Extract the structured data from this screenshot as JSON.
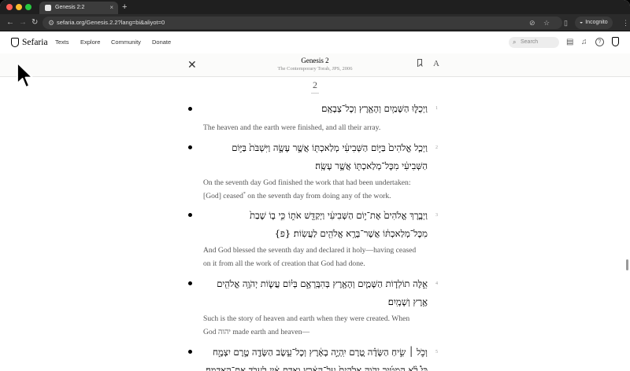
{
  "browser": {
    "tab_title": "Genesis 2:2",
    "tab_close": "×",
    "new_tab": "+",
    "url": "sefaria.org/Genesis.2.2?lang=bi&aliyot=0",
    "incognito_label": "Incognito",
    "icons": [
      "back-icon",
      "forward-icon",
      "reload-icon",
      "site-info-icon",
      "eye-slash-icon",
      "star-icon",
      "sidebar-icon",
      "incognito-icon",
      "menu-icon"
    ]
  },
  "site": {
    "logo_text": "Sefaria",
    "nav": [
      "Texts",
      "Explore",
      "Community",
      "Donate"
    ],
    "search_placeholder": "Search",
    "icons": [
      "search-icon",
      "saved-icon",
      "bell-icon",
      "help-icon",
      "sefaria-mini-logo"
    ]
  },
  "reader": {
    "close": "✕",
    "title": "Genesis 2",
    "subtitle": "The Contemporary Torah, JPS, 2006",
    "font_button": "A"
  },
  "chapter": "2",
  "verses": [
    {
      "num": "1",
      "hebrew": "וַיְכֻלּ֛וּ הַשָּׁמַ֥יִם וְהָאָ֖רֶץ וְכׇל־צְבָאָֽם׃",
      "english": "The heaven and the earth were finished, and all their array."
    },
    {
      "num": "2",
      "hebrew": "וַיְכַ֤ל אֱלֹהִים֙ בַּיּ֣וֹם הַשְּׁבִיעִ֔י מְלַאכְתּ֖וֹ אֲשֶׁ֣ר עָשָׂ֑ה וַיִּשְׁבֹּת֙ בַּיּ֣וֹם הַשְּׁבִיעִ֔י מִכׇּל־מְלַאכְתּ֖וֹ אֲשֶׁ֥ר עָשָֽׂה׃",
      "english_a": "On the seventh day God finished the work that had been undertaken:",
      "english_b1": "[God] ceased",
      "english_sup": "*",
      "english_b2": " on the seventh day from doing any of the work."
    },
    {
      "num": "3",
      "hebrew": "וַיְבָ֤רֶךְ אֱלֹהִים֙ אֶת־י֣וֹם הַשְּׁבִיעִ֔י וַיְקַדֵּ֖שׁ אֹת֑וֹ כִּ֣י ב֤וֹ שָׁבַת֙ מִכׇּל־מְלַאכְתּ֔וֹ אֲשֶׁר־בָּרָ֥א אֱלֹהִ֖ים לַעֲשֽׂוֹת׃ {פ}",
      "english_a": "And God blessed the seventh day and declared it holy—having ceased",
      "english_b": "on it from all the work of creation that God had done."
    },
    {
      "num": "4",
      "hebrew": "אֵ֣לֶּה תוֹלְד֧וֹת הַשָּׁמַ֛יִם וְהָאָ֖רֶץ בְּהִבָּֽרְאָ֑ם בְּי֗וֹם עֲשׂ֛וֹת יְהֹוָ֥ה אֱלֹהִ֖ים אֶ֥רֶץ וְשָׁמָֽיִם׃",
      "english_a": "Such is the story of heaven and earth when they were created. When",
      "english_b": "God יהוה made earth and heaven—"
    },
    {
      "num": "5",
      "hebrew": "וְכֹ֣ל ׀ שִׂ֣יחַ הַשָּׂדֶ֗ה טֶ֚רֶם יִֽהְיֶ֣ה בָאָ֔רֶץ וְכׇל־עֵ֥שֶׂב הַשָּׂדֶ֖ה טֶ֣רֶם יִצְמָ֑ח כִּי֩ לֹ֨א הִמְטִ֜יר יְהֹוָ֤ה אֱלֹהִים֙ עַל־הָאָ֔רֶץ וְאָדָ֣ם אַ֔יִן לַעֲבֹ֖ד אֶת־הָאֲדָמָֽה׃"
    }
  ]
}
